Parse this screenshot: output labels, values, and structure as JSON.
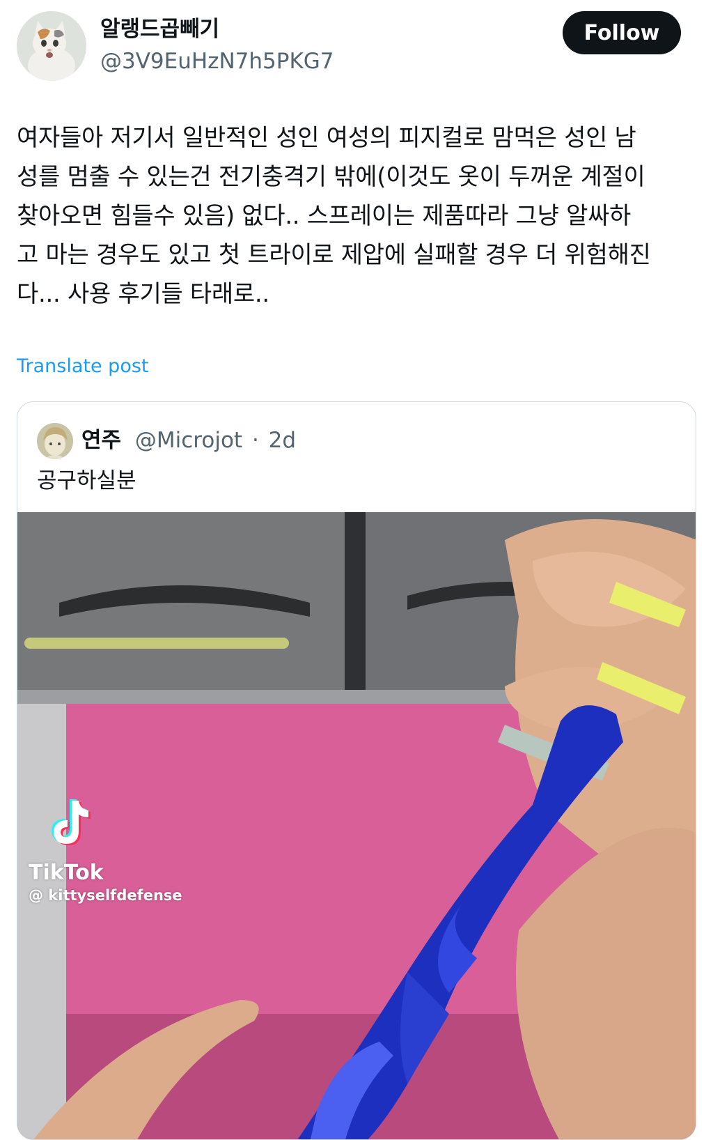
{
  "author": {
    "name": "알랭드곱빼기",
    "handle": "@3V9EuHzN7h5PKG7",
    "follow_label": "Follow"
  },
  "post": {
    "lines": [
      "여자들아 저기서 일반적인 성인 여성의 피지컬로 맘먹은 성인 남",
      "성를 멈출 수 있는건 전기충격기 밖에(이것도 옷이 두꺼운 계절이",
      "찾아오면 힘들수 있음) 없다.. 스프레이는 제품따라 그냥 알싸하",
      "고 마는 경우도 있고 첫 트라이로 제압에 실패할 경우 더 위험해진",
      "다... 사용 후기들 타래로.."
    ],
    "translate_label": "Translate post"
  },
  "quoted_post": {
    "name": "연주",
    "handle": "@Microjot",
    "separator": "·",
    "time": "2d",
    "text": "공구하실분"
  },
  "media": {
    "watermark_brand": "TikTok",
    "watermark_user": "@ kittyselfdefense"
  },
  "icons": {
    "tiktok": "tiktok-logo-icon"
  },
  "colors": {
    "link": "#1d9bf0",
    "secondary_text": "#536471",
    "follow_bg": "#0f1419",
    "border": "#cfd9de"
  }
}
